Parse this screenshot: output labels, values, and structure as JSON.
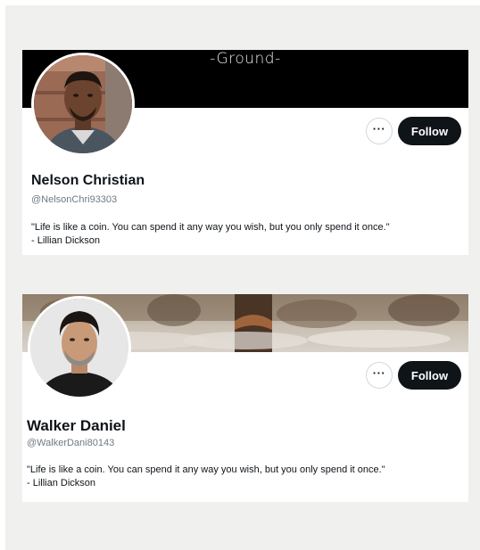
{
  "profiles": [
    {
      "banner_text": "-Ground-",
      "name": "Nelson Christian",
      "handle": "@NelsonChri93303",
      "bio_line1": "\"Life is like a coin. You can spend it any way you wish, but you only spend it once.\"",
      "bio_line2": "- Lillian Dickson",
      "more_label": "···",
      "follow_label": "Follow"
    },
    {
      "name": "Walker Daniel",
      "handle": "@WalkerDani80143",
      "bio_line1": "\"Life is like a coin. You can spend it any way you wish, but you only spend it once.\"",
      "bio_line2": "- Lillian Dickson",
      "more_label": "···",
      "follow_label": "Follow"
    }
  ],
  "colors": {
    "page_background": "#f0f1ef",
    "follow_button": "#0f1419",
    "handle_text": "#6f7a83"
  }
}
